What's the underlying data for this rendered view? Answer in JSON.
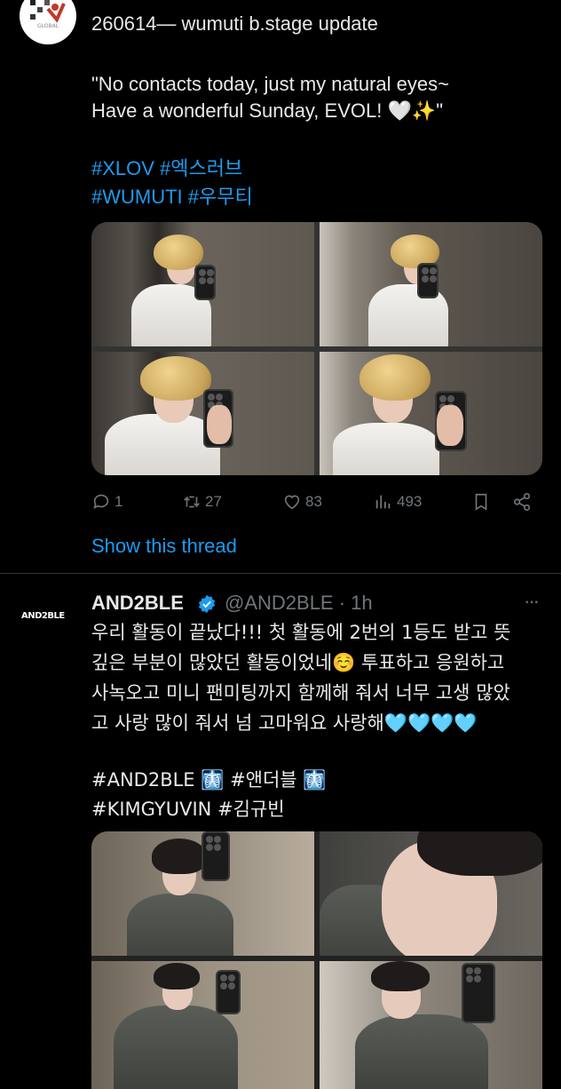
{
  "tweet1": {
    "title_line": "260614— wumuti b.stage update",
    "quote_line1": "\"No contacts today, just my natural eyes~",
    "quote_line2": "Have a wonderful Sunday, EVOL! 🤍✨\"",
    "hashtags_line1": "#XLOV #엑스러브",
    "hashtags_line2": "#WUMUTI #우무티",
    "avatar_caption": "GLOBAL",
    "actions": {
      "replies": "1",
      "retweets": "27",
      "likes": "83",
      "views": "493"
    },
    "show_thread": "Show this thread"
  },
  "tweet2": {
    "avatar_text": "AND2BLE",
    "display_name": "AND2BLE",
    "handle_time": "@AND2BLE · 1h",
    "more": "···",
    "body_line1": "우리 활동이 끝났다!!! 첫 활동에 2번의 1등도 받고 뜻",
    "body_line2": "깊은 부분이 많았던 활동이었네☺️ 투표하고 응원하고",
    "body_line3": "사녹오고 미니 팬미팅까지 함께해 줘서 너무 고생 많았",
    "body_line4": "고 사랑 많이 줘서 넘 고마워요 사랑해🩵🩵🩵🩵",
    "hashtags_line1": "#AND2BLE 🩻 #앤더블 🩻",
    "hashtags_line2": "#KIMGYUVIN #김규빈"
  },
  "colors": {
    "background": "#000000",
    "text": "#e7e9ea",
    "accent": "#1d9bf0",
    "muted": "#71767b",
    "divider": "#2f3336"
  },
  "icons": [
    "reply-icon",
    "retweet-icon",
    "like-icon",
    "views-icon",
    "bookmark-icon",
    "share-icon",
    "verified-badge-icon",
    "more-icon"
  ]
}
